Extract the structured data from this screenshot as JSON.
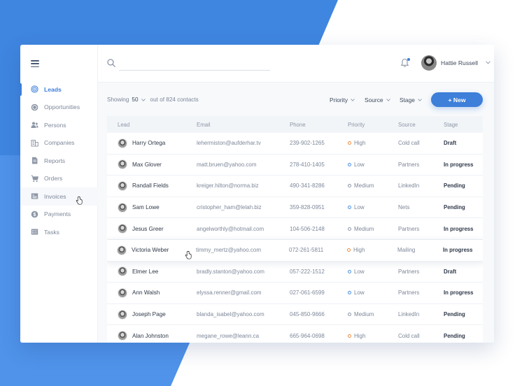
{
  "colors": {
    "accent": "#3d7fd9",
    "bg_blue": "#3f86e0",
    "priority_high": "#f08a3c",
    "priority_low": "#4a90e2",
    "priority_medium": "#8d96a6"
  },
  "sidebar": {
    "menu_icon": "hamburger-icon",
    "items": [
      {
        "label": "Leads",
        "icon": "target-icon",
        "active": true
      },
      {
        "label": "Opportunities",
        "icon": "coin-icon"
      },
      {
        "label": "Persons",
        "icon": "persons-icon"
      },
      {
        "label": "Companies",
        "icon": "building-icon"
      },
      {
        "label": "Reports",
        "icon": "report-icon"
      },
      {
        "label": "Orders",
        "icon": "cart-icon"
      },
      {
        "label": "Invoices",
        "icon": "invoice-icon",
        "hover": true
      },
      {
        "label": "Payments",
        "icon": "dollar-icon"
      },
      {
        "label": "Tasks",
        "icon": "tasks-icon"
      }
    ]
  },
  "header": {
    "search_placeholder": "",
    "user_name": "Hattie Russell"
  },
  "toolbar": {
    "showing_label": "Showing",
    "page_size": "50",
    "out_of": "out of 824 contacts",
    "filters": [
      "Priority",
      "Source",
      "Stage"
    ],
    "new_button": "+ New"
  },
  "table": {
    "columns": [
      "Lead",
      "Email",
      "Phone",
      "Priority",
      "Source",
      "Stage"
    ],
    "rows": [
      {
        "lead": "Harry Ortega",
        "email": "lehermiston@aufderhar.tv",
        "phone": "239-902-1265",
        "priority": "High",
        "source": "Cold call",
        "stage": "Draft"
      },
      {
        "lead": "Max Glover",
        "email": "matt.bruen@yahoo.com",
        "phone": "278-410-1405",
        "priority": "Low",
        "source": "Partners",
        "stage": "In progress"
      },
      {
        "lead": "Randall Fields",
        "email": "kreiger.hilton@norma.biz",
        "phone": "490-341-8286",
        "priority": "Medium",
        "source": "LinkedIn",
        "stage": "Pending"
      },
      {
        "lead": "Sam Lowe",
        "email": "cristopher_ham@lelah.biz",
        "phone": "359-828-0951",
        "priority": "Low",
        "source": "Nets",
        "stage": "Pending"
      },
      {
        "lead": "Jesus Greer",
        "email": "angelworthly@hotmail.com",
        "phone": "104-506-2148",
        "priority": "Medium",
        "source": "Partners",
        "stage": "In progress"
      },
      {
        "lead": "Victoria Weber",
        "email": "timmy_mertz@yahoo.com",
        "phone": "072-261-5811",
        "priority": "High",
        "source": "Mailing",
        "stage": "In progress",
        "hover": true
      },
      {
        "lead": "Elmer Lee",
        "email": "bradly.stanton@yahoo.com",
        "phone": "057-222-1512",
        "priority": "Low",
        "source": "Partners",
        "stage": "Draft"
      },
      {
        "lead": "Ann Walsh",
        "email": "elyssa.renner@gmail.com",
        "phone": "027-061-6599",
        "priority": "Low",
        "source": "Partners",
        "stage": "In progress"
      },
      {
        "lead": "Joseph Page",
        "email": "blanda_isabel@yahoo.com",
        "phone": "045-850-9666",
        "priority": "Medium",
        "source": "LinkedIn",
        "stage": "Pending"
      },
      {
        "lead": "Alan Johnston",
        "email": "megane_rowe@leann.ca",
        "phone": "665-964-0698",
        "priority": "High",
        "source": "Cold call",
        "stage": "Pending"
      }
    ]
  }
}
